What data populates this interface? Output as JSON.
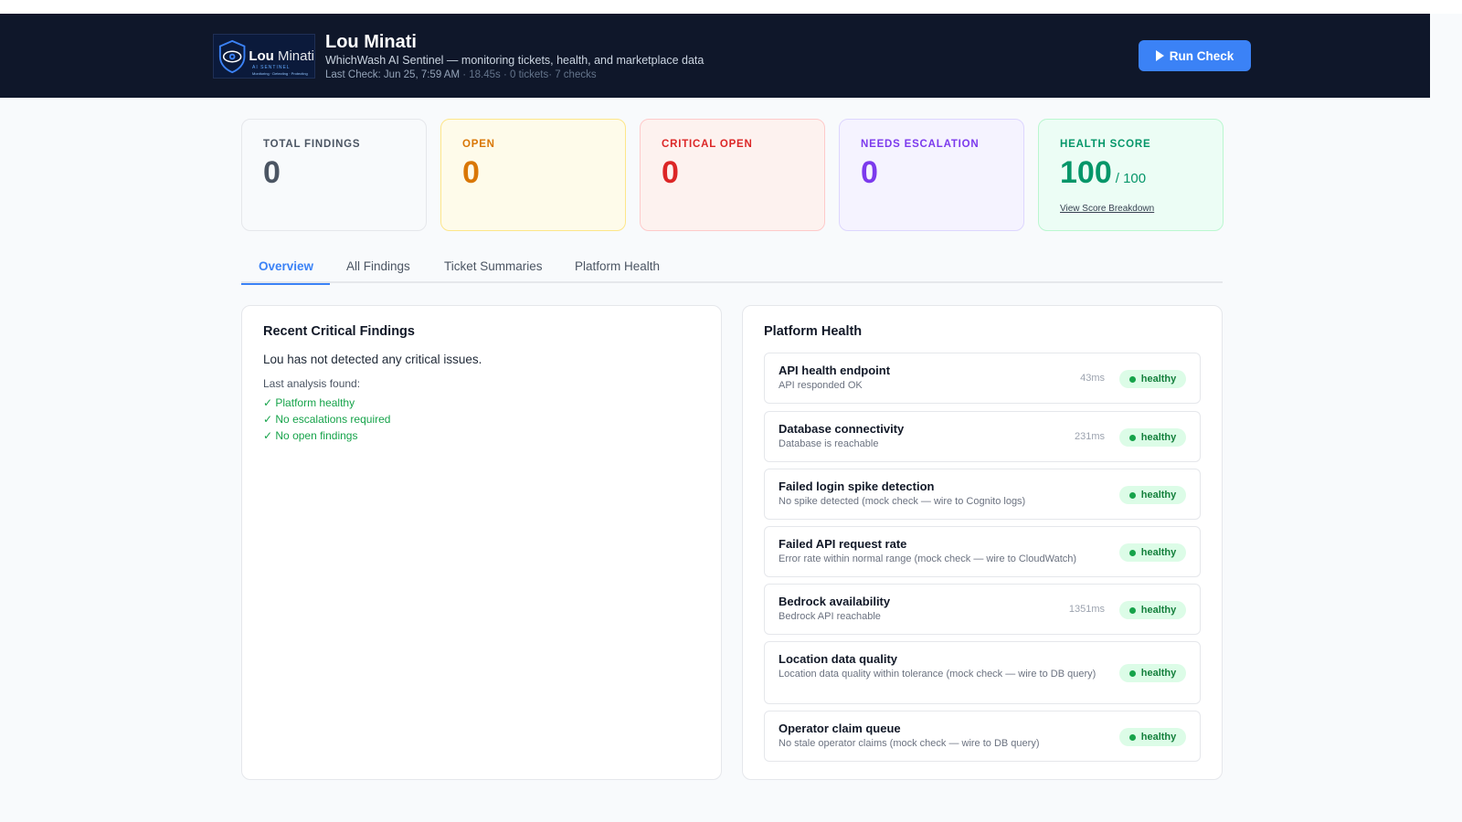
{
  "header": {
    "logo_text_main": "Lou",
    "logo_text_light": "Minati",
    "logo_sub": "AI SENTINEL",
    "logo_sub2": "Monitoring · Detecting · Protecting",
    "title": "Lou Minati",
    "subtitle": "WhichWash AI Sentinel — monitoring tickets, health, and marketplace data",
    "last_check": "Last Check: Jun 25, 7:59 AM",
    "meta_stats": "· 18.45s · 0 tickets· 7 checks",
    "run_button": "Run Check"
  },
  "stats": [
    {
      "label": "TOTAL FINDINGS",
      "value": "0",
      "color": "#6b7280"
    },
    {
      "label": "OPEN",
      "value": "0",
      "color": "#d97706"
    },
    {
      "label": "CRITICAL OPEN",
      "value": "0",
      "color": "#dc2626"
    },
    {
      "label": "NEEDS ESCALATION",
      "value": "0",
      "color": "#7c3aed"
    },
    {
      "label": "HEALTH SCORE",
      "value": "100",
      "out_of": "/ 100",
      "link": "View Score Breakdown",
      "color": "#059669"
    }
  ],
  "tabs": [
    "Overview",
    "All Findings",
    "Ticket Summaries",
    "Platform Health"
  ],
  "critical": {
    "title": "Recent Critical Findings",
    "message": "Lou has not detected any critical issues.",
    "sub": "Last analysis found:",
    "checks": [
      "✓ Platform healthy",
      "✓ No escalations required",
      "✓ No open findings"
    ]
  },
  "health": {
    "title": "Platform Health",
    "items": [
      {
        "name": "API health endpoint",
        "desc": "API responded OK",
        "ms": "43ms",
        "status": "healthy"
      },
      {
        "name": "Database connectivity",
        "desc": "Database is reachable",
        "ms": "231ms",
        "status": "healthy"
      },
      {
        "name": "Failed login spike detection",
        "desc": "No spike detected (mock check — wire to Cognito logs)",
        "ms": "",
        "status": "healthy"
      },
      {
        "name": "Failed API request rate",
        "desc": "Error rate within normal range (mock check — wire to CloudWatch)",
        "ms": "",
        "status": "healthy"
      },
      {
        "name": "Bedrock availability",
        "desc": "Bedrock API reachable",
        "ms": "1351ms",
        "status": "healthy"
      },
      {
        "name": "Location data quality",
        "desc": "Location data quality within tolerance (mock check — wire to DB query)",
        "ms": "",
        "status": "healthy"
      },
      {
        "name": "Operator claim queue",
        "desc": "No stale operator claims (mock check — wire to DB query)",
        "ms": "",
        "status": "healthy"
      }
    ]
  }
}
